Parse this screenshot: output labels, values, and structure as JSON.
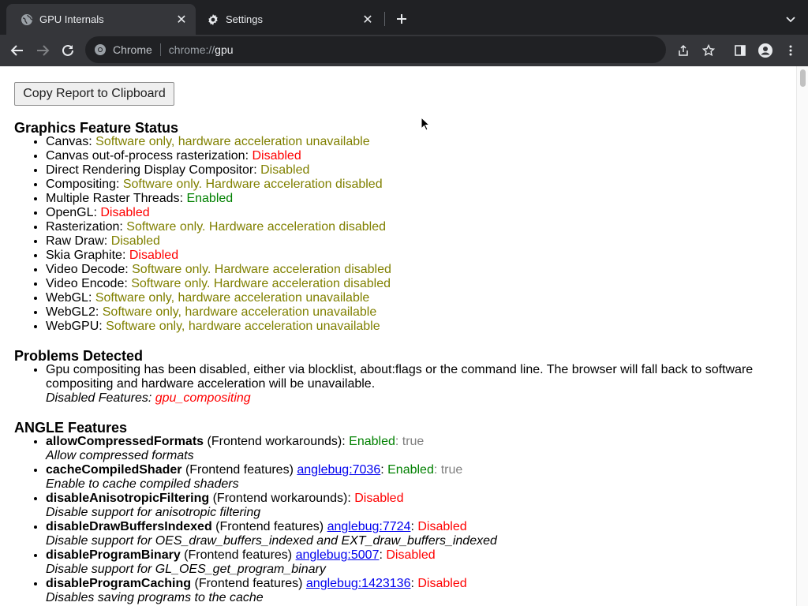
{
  "browser": {
    "tabs": [
      {
        "title": "GPU Internals",
        "icon": "globe-icon",
        "active": true
      },
      {
        "title": "Settings",
        "icon": "gear-icon",
        "active": false
      }
    ],
    "omnibox": {
      "chip": "Chrome",
      "scheme": "chrome://",
      "host": "gpu"
    }
  },
  "page": {
    "copy_button": "Copy Report to Clipboard",
    "feature_status": {
      "heading": "Graphics Feature Status",
      "items": [
        {
          "name": "Canvas",
          "status": "Software only, hardware acceleration unavailable",
          "color": "yellow"
        },
        {
          "name": "Canvas out-of-process rasterization",
          "status": "Disabled",
          "color": "red"
        },
        {
          "name": "Direct Rendering Display Compositor",
          "status": "Disabled",
          "color": "yellow"
        },
        {
          "name": "Compositing",
          "status": "Software only. Hardware acceleration disabled",
          "color": "yellow"
        },
        {
          "name": "Multiple Raster Threads",
          "status": "Enabled",
          "color": "green"
        },
        {
          "name": "OpenGL",
          "status": "Disabled",
          "color": "red"
        },
        {
          "name": "Rasterization",
          "status": "Software only. Hardware acceleration disabled",
          "color": "yellow"
        },
        {
          "name": "Raw Draw",
          "status": "Disabled",
          "color": "yellow"
        },
        {
          "name": "Skia Graphite",
          "status": "Disabled",
          "color": "red"
        },
        {
          "name": "Video Decode",
          "status": "Software only. Hardware acceleration disabled",
          "color": "yellow"
        },
        {
          "name": "Video Encode",
          "status": "Software only. Hardware acceleration disabled",
          "color": "yellow"
        },
        {
          "name": "WebGL",
          "status": "Software only, hardware acceleration unavailable",
          "color": "yellow"
        },
        {
          "name": "WebGL2",
          "status": "Software only, hardware acceleration unavailable",
          "color": "yellow"
        },
        {
          "name": "WebGPU",
          "status": "Software only, hardware acceleration unavailable",
          "color": "yellow"
        }
      ]
    },
    "problems": {
      "heading": "Problems Detected",
      "text": "Gpu compositing has been disabled, either via blocklist, about:flags or the command line. The browser will fall back to software compositing and hardware acceleration will be unavailable.",
      "disabled_label": "Disabled Features: ",
      "disabled_value": "gpu_compositing"
    },
    "angle": {
      "heading": "ANGLE Features",
      "items": [
        {
          "name": "allowCompressedFormats",
          "category": " (Frontend workarounds)",
          "bug": "",
          "status": "Enabled",
          "status_color": "green",
          "extra": ": true",
          "desc": "Allow compressed formats"
        },
        {
          "name": "cacheCompiledShader",
          "category": " (Frontend features) ",
          "bug": "anglebug:7036",
          "status": "Enabled",
          "status_color": "green",
          "extra": ": true",
          "desc": "Enable to cache compiled shaders"
        },
        {
          "name": "disableAnisotropicFiltering",
          "category": " (Frontend workarounds)",
          "bug": "",
          "status": "Disabled",
          "status_color": "red",
          "extra": "",
          "desc": "Disable support for anisotropic filtering"
        },
        {
          "name": "disableDrawBuffersIndexed",
          "category": " (Frontend features) ",
          "bug": "anglebug:7724",
          "status": "Disabled",
          "status_color": "red",
          "extra": "",
          "desc": "Disable support for OES_draw_buffers_indexed and EXT_draw_buffers_indexed"
        },
        {
          "name": "disableProgramBinary",
          "category": " (Frontend features) ",
          "bug": "anglebug:5007",
          "status": "Disabled",
          "status_color": "red",
          "extra": "",
          "desc": "Disable support for GL_OES_get_program_binary"
        },
        {
          "name": "disableProgramCaching",
          "category": " (Frontend features) ",
          "bug": "anglebug:1423136",
          "status": "Disabled",
          "status_color": "red",
          "extra": "",
          "desc": "Disables saving programs to the cache"
        }
      ]
    }
  }
}
